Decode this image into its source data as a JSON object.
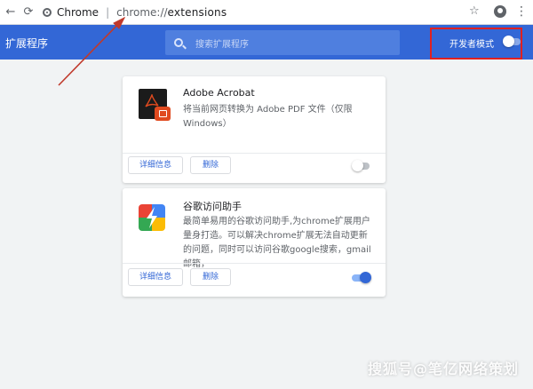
{
  "browser": {
    "brand": "Chrome",
    "url_scheme": "chrome://",
    "url_path": "extensions"
  },
  "header": {
    "title": "扩展程序",
    "search_placeholder": "搜索扩展程序",
    "dev_mode_label": "开发者模式",
    "dev_mode_enabled": false
  },
  "extensions": [
    {
      "name": "Adobe Acrobat",
      "description": "将当前网页转换为 Adobe PDF 文件（仅限 Windows）",
      "details_label": "详细信息",
      "remove_label": "删除",
      "enabled": false
    },
    {
      "name": "谷歌访问助手",
      "description": "最简单易用的谷歌访问助手,为chrome扩展用户量身打造。可以解决chrome扩展无法自动更新的问题，同时可以访问谷歌google搜索，gmail邮箱，",
      "details_label": "详细信息",
      "remove_label": "删除",
      "enabled": true
    }
  ],
  "watermark": "搜狐号@笔亿网络策划",
  "colors": {
    "header_blue": "#3367d6",
    "annotation_red": "#e02020",
    "toggle_on": "#3367d6"
  }
}
